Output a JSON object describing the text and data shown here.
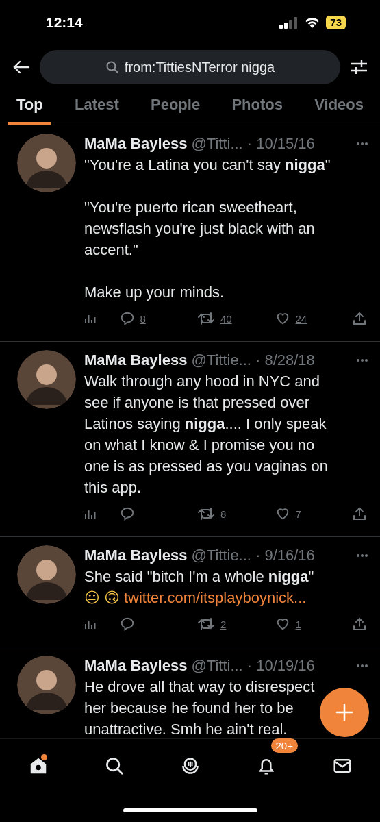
{
  "status_bar": {
    "time": "12:14",
    "battery": "73"
  },
  "search": {
    "value": "from:TittiesNTerror nigga"
  },
  "tabs": [
    {
      "label": "Top",
      "selected": true
    },
    {
      "label": "Latest",
      "selected": false
    },
    {
      "label": "People",
      "selected": false
    },
    {
      "label": "Photos",
      "selected": false
    },
    {
      "label": "Videos",
      "selected": false
    }
  ],
  "tweets": [
    {
      "name": "MaMa Bayless",
      "handle": "@Titti...",
      "date": "· 10/15/16",
      "paragraphs": [
        "\"You're a Latina you can't say **nigga**\"",
        "\"You're puerto rican sweetheart, newsflash you're just black with an accent.\"",
        "Make up your minds."
      ],
      "stats": {
        "replies": "8",
        "retweets": "40",
        "likes": "24"
      }
    },
    {
      "name": "MaMa Bayless",
      "handle": "@Tittie...",
      "date": "· 8/28/18",
      "paragraphs": [
        "Walk through any hood in NYC and see if anyone is that pressed over Latinos saying **nigga**.... I only speak on what I know & I promise you no one is as pressed as you vaginas on this app."
      ],
      "stats": {
        "retweets": "8",
        "likes": "7"
      }
    },
    {
      "name": "MaMa Bayless",
      "handle": "@Tittie...",
      "date": "· 9/16/16",
      "paragraphs": [
        "She said \"bitch I'm a whole **nigga**\""
      ],
      "emoji": [
        "😐",
        "🙃"
      ],
      "link": "twitter.com/itsplayboynick...",
      "stats": {
        "retweets": "2",
        "likes": "1"
      }
    },
    {
      "name": "MaMa Bayless",
      "handle": "@Titti...",
      "date": "· 10/19/16",
      "paragraphs": [
        "He drove all that way to disrespect her because he found her to be unattractive. Smh he ain't real."
      ]
    }
  ],
  "nav": [
    {
      "kind": "home",
      "dot": true
    },
    {
      "kind": "search"
    },
    {
      "kind": "spaces"
    },
    {
      "kind": "notifications",
      "badge": "20+"
    },
    {
      "kind": "messages"
    }
  ]
}
